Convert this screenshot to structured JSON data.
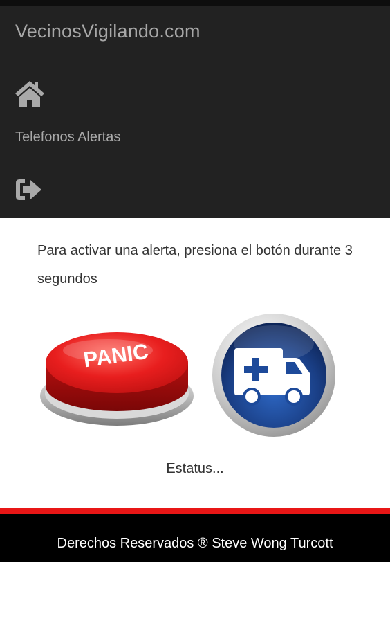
{
  "navbar": {
    "brand": "VecinosVigilando.com",
    "home_icon": "home-icon",
    "alerts_label": "Telefonos Alertas",
    "logout_icon": "sign-out-icon"
  },
  "main": {
    "instructions": "Para activar una alerta, presiona el botón durante 3 segundos",
    "panic_label": "PANIC",
    "ambulance_icon": "ambulance-icon",
    "status": "Estatus..."
  },
  "footer": {
    "text": "Derechos Reservados ® Steve Wong Turcott"
  },
  "colors": {
    "navbar_bg": "#222222",
    "accent_red": "#e81616",
    "panic_red": "#e01b1b",
    "ambulance_blue": "#1a3f86",
    "footer_bg": "#000000"
  }
}
